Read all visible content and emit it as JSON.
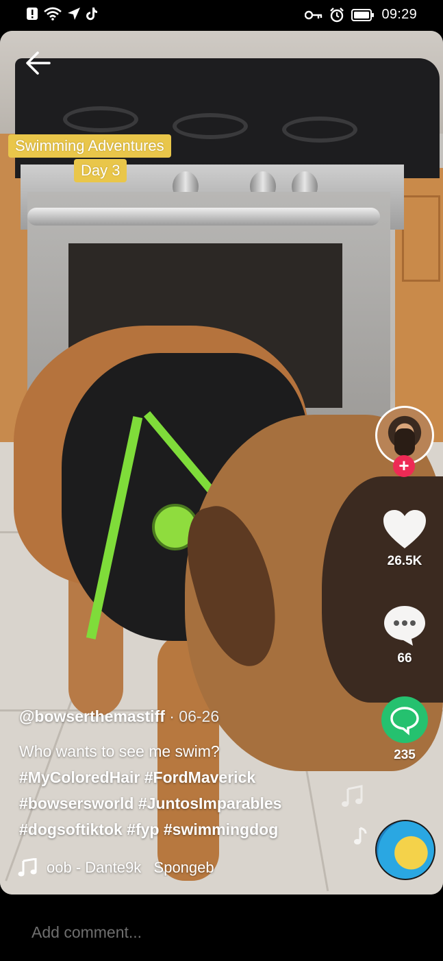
{
  "status_bar": {
    "time": "09:29",
    "left_icons": [
      "notification-icon",
      "wifi-icon",
      "location-icon",
      "tiktok-icon"
    ],
    "right_icons": [
      "key-icon",
      "alarm-icon",
      "battery-icon"
    ]
  },
  "video": {
    "caption_line1": "Swimming Adventures",
    "caption_line2": "Day 3"
  },
  "author": {
    "handle": "@bowserthemastiff",
    "separator_date": " · 06-26"
  },
  "description": "Who wants to see me swim?",
  "hashtags": {
    "line1": "#MyColoredHair #FordMaverick",
    "line2": "#bowsersworld #JuntosImparables",
    "line3": "#dogsoftiktok #fyp #swimmingdog"
  },
  "music": {
    "track": "oob - Dante9k   Spongeb"
  },
  "actions": {
    "likes": "26.5K",
    "comments": "66",
    "shares": "235"
  },
  "comment_bar": {
    "placeholder": "Add comment..."
  },
  "colors": {
    "follow_plus": "#ee2a55",
    "share_green": "#25c16f",
    "caption_bg": "#e9c64a"
  }
}
